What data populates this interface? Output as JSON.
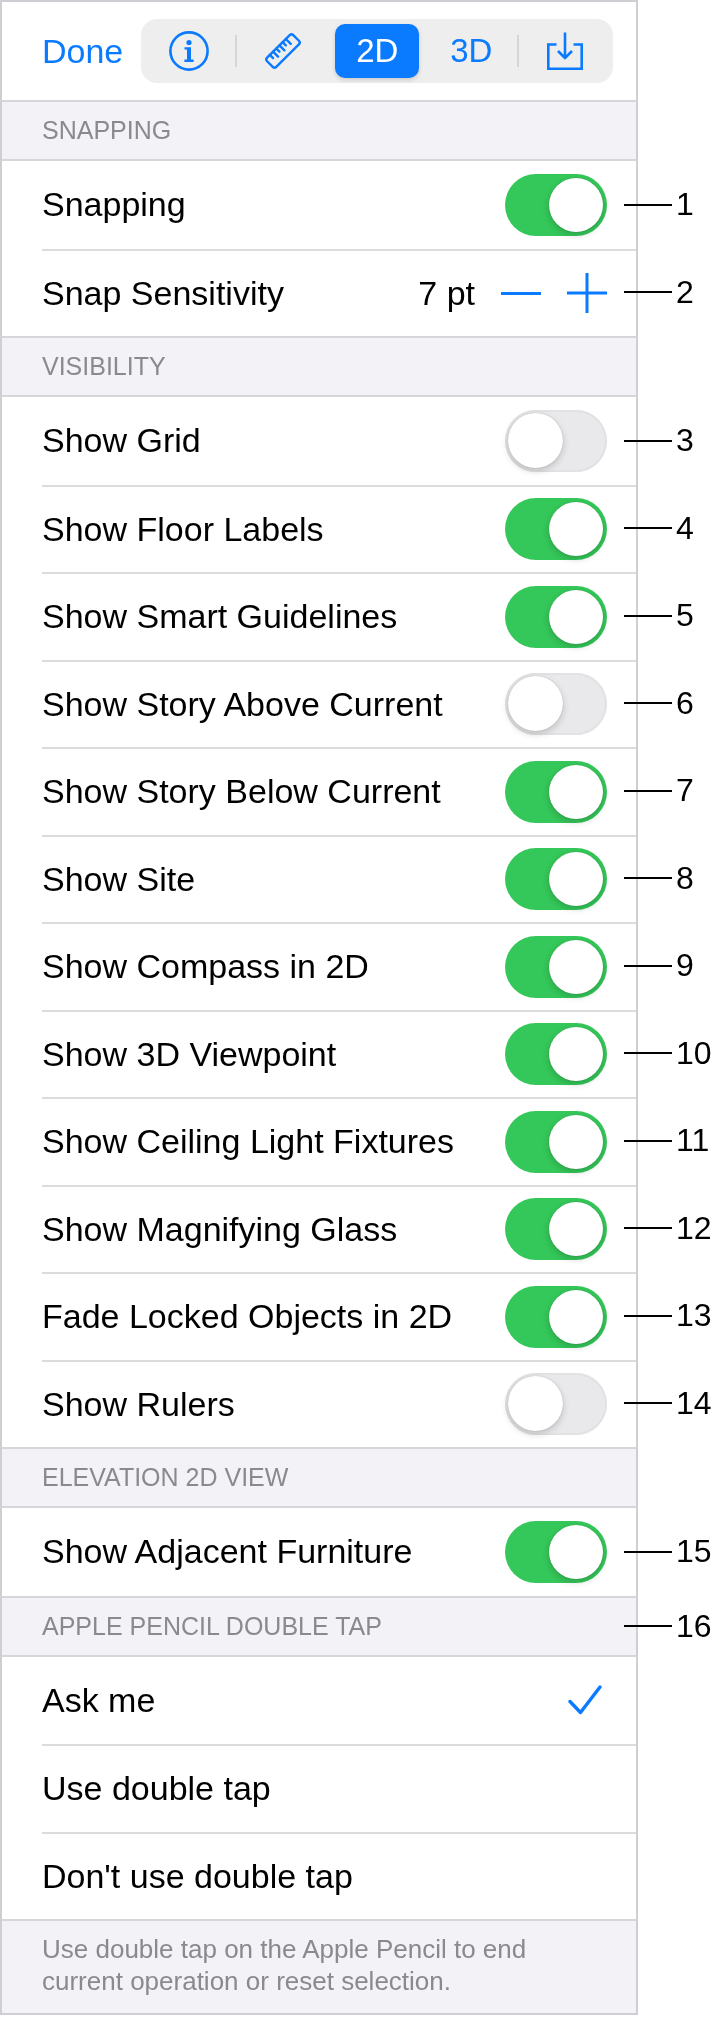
{
  "toolbar": {
    "done": "Done",
    "segments": [
      {
        "kind": "info",
        "selected": false
      },
      {
        "kind": "ruler",
        "selected": false
      },
      {
        "kind": "label",
        "label": "2D",
        "selected": true
      },
      {
        "kind": "label",
        "label": "3D",
        "selected": false
      },
      {
        "kind": "export",
        "selected": false
      }
    ]
  },
  "sections": [
    {
      "header": "SNAPPING",
      "rows": [
        {
          "kind": "toggle",
          "label": "Snapping",
          "on": true,
          "callout": "1"
        },
        {
          "kind": "stepper",
          "label": "Snap Sensitivity",
          "value": "7 pt",
          "callout": "2"
        }
      ]
    },
    {
      "header": "VISIBILITY",
      "rows": [
        {
          "kind": "toggle",
          "label": "Show Grid",
          "on": false,
          "callout": "3"
        },
        {
          "kind": "toggle",
          "label": "Show Floor Labels",
          "on": true,
          "callout": "4"
        },
        {
          "kind": "toggle",
          "label": "Show Smart Guidelines",
          "on": true,
          "callout": "5"
        },
        {
          "kind": "toggle",
          "label": "Show Story Above Current",
          "on": false,
          "callout": "6"
        },
        {
          "kind": "toggle",
          "label": "Show Story Below Current",
          "on": true,
          "callout": "7"
        },
        {
          "kind": "toggle",
          "label": "Show Site",
          "on": true,
          "callout": "8"
        },
        {
          "kind": "toggle",
          "label": "Show Compass in 2D",
          "on": true,
          "callout": "9"
        },
        {
          "kind": "toggle",
          "label": "Show 3D Viewpoint",
          "on": true,
          "callout": "10"
        },
        {
          "kind": "toggle",
          "label": "Show Ceiling Light Fixtures",
          "on": true,
          "callout": "11"
        },
        {
          "kind": "toggle",
          "label": "Show Magnifying Glass",
          "on": true,
          "callout": "12"
        },
        {
          "kind": "toggle",
          "label": "Fade Locked Objects in 2D",
          "on": true,
          "callout": "13"
        },
        {
          "kind": "toggle",
          "label": "Show Rulers",
          "on": false,
          "callout": "14"
        }
      ]
    },
    {
      "header": "ELEVATION 2D VIEW",
      "rows": [
        {
          "kind": "toggle",
          "label": "Show Adjacent Furniture",
          "on": true,
          "callout": "15"
        }
      ]
    },
    {
      "header": "APPLE PENCIL DOUBLE TAP",
      "header_callout": "16",
      "rows": [
        {
          "kind": "choice",
          "label": "Ask me",
          "selected": true
        },
        {
          "kind": "choice",
          "label": "Use double tap",
          "selected": false
        },
        {
          "kind": "choice",
          "label": "Don't use double tap",
          "selected": false
        }
      ],
      "footer": "Use double tap on the Apple Pencil to end current operation or reset selection."
    }
  ]
}
